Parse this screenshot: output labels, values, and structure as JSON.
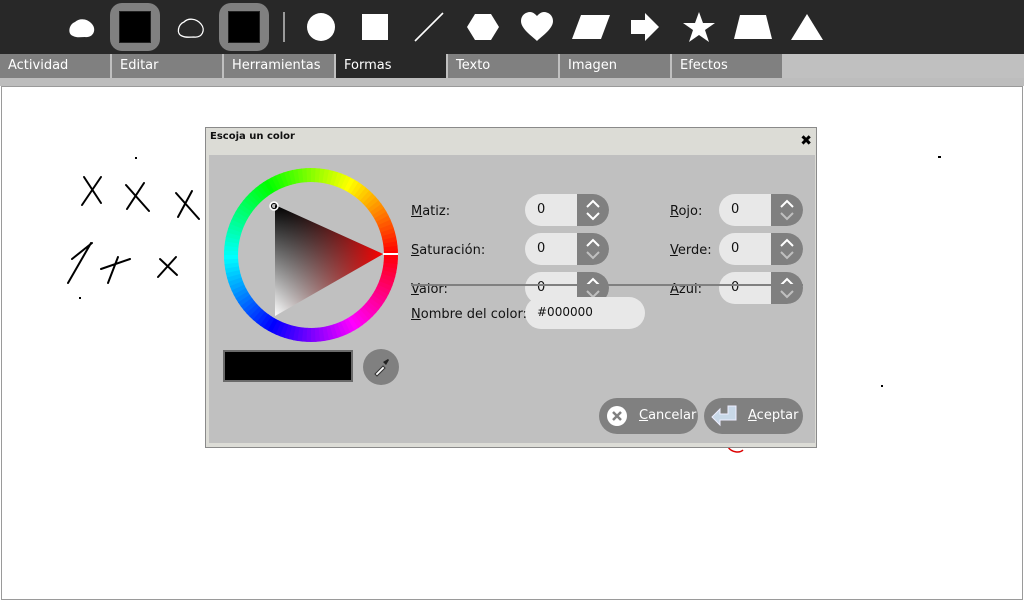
{
  "toolbar": {
    "tools": [
      {
        "icon": "freeform-filled-icon",
        "selected": false
      },
      {
        "icon": "fill-color-swatch-icon",
        "selected": true
      },
      {
        "icon": "freeform-outline-icon",
        "selected": false
      },
      {
        "icon": "stroke-color-swatch-icon",
        "selected": true
      },
      {
        "icon": "circle-icon",
        "selected": false
      },
      {
        "icon": "square-icon",
        "selected": false
      },
      {
        "icon": "line-icon",
        "selected": false
      },
      {
        "icon": "hexagon-icon",
        "selected": false
      },
      {
        "icon": "heart-icon",
        "selected": false
      },
      {
        "icon": "parallelogram-icon",
        "selected": false
      },
      {
        "icon": "arrow-icon",
        "selected": false
      },
      {
        "icon": "star-icon",
        "selected": false
      },
      {
        "icon": "trapezoid-icon",
        "selected": false
      },
      {
        "icon": "triangle-icon",
        "selected": false
      }
    ]
  },
  "tabs": [
    {
      "label": "Actividad",
      "active": false
    },
    {
      "label": "Editar",
      "active": false
    },
    {
      "label": "Herramientas",
      "active": false
    },
    {
      "label": "Formas",
      "active": true
    },
    {
      "label": "Texto",
      "active": false
    },
    {
      "label": "Imagen",
      "active": false
    },
    {
      "label": "Efectos",
      "active": false
    }
  ],
  "dialog": {
    "title": "Escoja un color",
    "close_icon": "close-icon",
    "fields": {
      "hue": {
        "label_first": "M",
        "label_rest": "atiz:",
        "value": "0"
      },
      "saturation": {
        "label_first": "S",
        "label_rest": "aturación:",
        "value": "0"
      },
      "value": {
        "label_first": "V",
        "label_rest": "alor:",
        "value": "0"
      },
      "red": {
        "label_first": "R",
        "label_rest": "ojo:",
        "value": "0"
      },
      "green": {
        "label_first": "V",
        "label_rest": "erde:",
        "value": "0"
      },
      "blue": {
        "label_first": "A",
        "label_rest": "zul:",
        "value": "0"
      }
    },
    "color_name": {
      "label_first": "N",
      "label_rest": "ombre del color:",
      "value": "#000000"
    },
    "current_color": "#000000",
    "cancel": {
      "first": "C",
      "rest": "ancelar",
      "icon": "cancel-icon"
    },
    "accept": {
      "first": "A",
      "rest": "ceptar",
      "icon": "enter-icon"
    }
  },
  "colors": {
    "toolbar_bg": "#282828",
    "tab_bg": "#808080",
    "tab_active_bg": "#282828",
    "dialog_bg": "#c0c0c0"
  }
}
